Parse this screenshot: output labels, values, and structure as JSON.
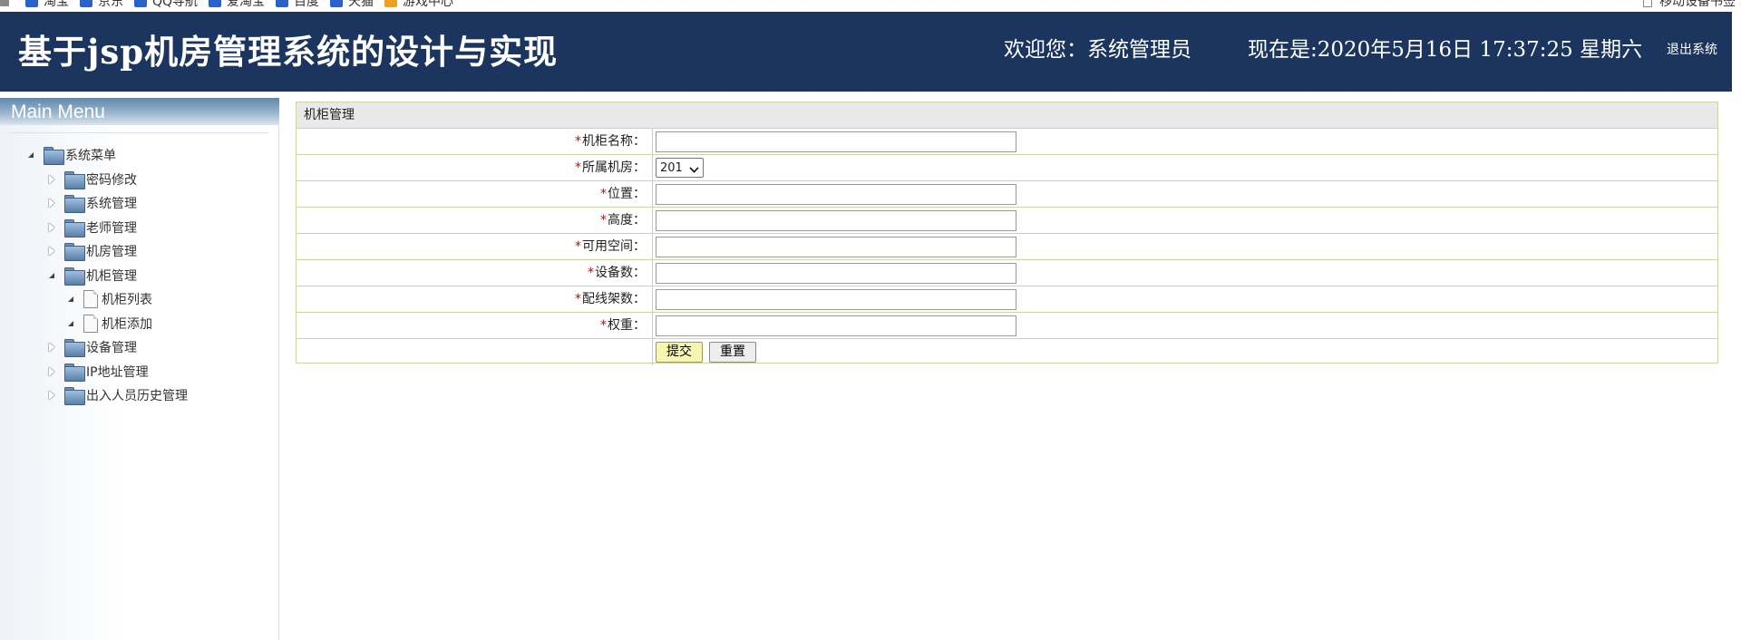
{
  "bookmarks": {
    "items": [
      "淘宝",
      "京东",
      "QQ导航",
      "爱淘宝",
      "百度",
      "天猫",
      "游戏中心"
    ],
    "right_label": "移动设备书签"
  },
  "header": {
    "title": "基于jsp机房管理系统的设计与实现",
    "welcome": "欢迎您：系统管理员",
    "clock": "现在是:2020年5月16日 17:37:25 星期六",
    "logout": "退出系统"
  },
  "sidebar": {
    "menu_title": "Main Menu",
    "root": "系统菜单",
    "items": [
      {
        "label": "密码修改",
        "level": 1,
        "type": "folder",
        "expanded": false
      },
      {
        "label": "系统管理",
        "level": 1,
        "type": "folder",
        "expanded": false
      },
      {
        "label": "老师管理",
        "level": 1,
        "type": "folder",
        "expanded": false
      },
      {
        "label": "机房管理",
        "level": 1,
        "type": "folder",
        "expanded": false
      },
      {
        "label": "机柜管理",
        "level": 1,
        "type": "folder",
        "expanded": true
      },
      {
        "label": "机柜列表",
        "level": 2,
        "type": "page"
      },
      {
        "label": "机柜添加",
        "level": 2,
        "type": "page"
      },
      {
        "label": "设备管理",
        "level": 1,
        "type": "folder",
        "expanded": false
      },
      {
        "label": "IP地址管理",
        "level": 1,
        "type": "folder",
        "expanded": false
      },
      {
        "label": "出入人员历史管理",
        "level": 1,
        "type": "folder",
        "expanded": false
      }
    ]
  },
  "form": {
    "title": "机柜管理",
    "required_mark": "*",
    "fields": [
      {
        "label": "机柜名称：",
        "value": ""
      },
      {
        "label": "所属机房：",
        "value": "201"
      },
      {
        "label": "位置：",
        "value": ""
      },
      {
        "label": "高度：",
        "value": ""
      },
      {
        "label": "可用空间：",
        "value": ""
      },
      {
        "label": "设备数：",
        "value": ""
      },
      {
        "label": "配线架数：",
        "value": ""
      },
      {
        "label": "权重：",
        "value": ""
      }
    ],
    "submit_label": "提交",
    "reset_label": "重置"
  }
}
